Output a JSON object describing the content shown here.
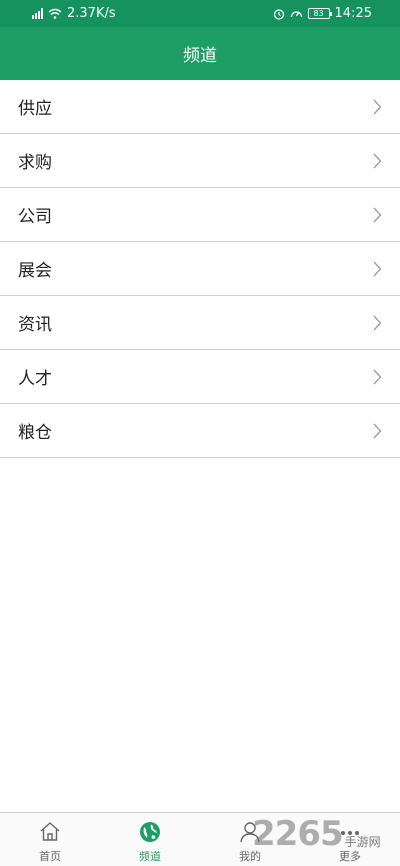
{
  "status_bar": {
    "network_speed": "2.37K/s",
    "battery": "83",
    "time": "14:25"
  },
  "header": {
    "title": "频道"
  },
  "list": {
    "items": [
      {
        "label": "供应"
      },
      {
        "label": "求购"
      },
      {
        "label": "公司"
      },
      {
        "label": "展会"
      },
      {
        "label": "资讯"
      },
      {
        "label": "人才"
      },
      {
        "label": "粮仓"
      }
    ]
  },
  "tabbar": {
    "tabs": [
      {
        "label": "首页",
        "icon": "home-icon",
        "active": false
      },
      {
        "label": "频道",
        "icon": "globe-icon",
        "active": true
      },
      {
        "label": "我的",
        "icon": "user-icon",
        "active": false
      },
      {
        "label": "更多",
        "icon": "more-icon",
        "active": false
      }
    ],
    "active_color": "#1e9e65"
  },
  "watermark": {
    "big": "2265",
    "small": "手游网"
  },
  "colors": {
    "accent": "#1e9e65",
    "status_bar": "#15925e"
  }
}
